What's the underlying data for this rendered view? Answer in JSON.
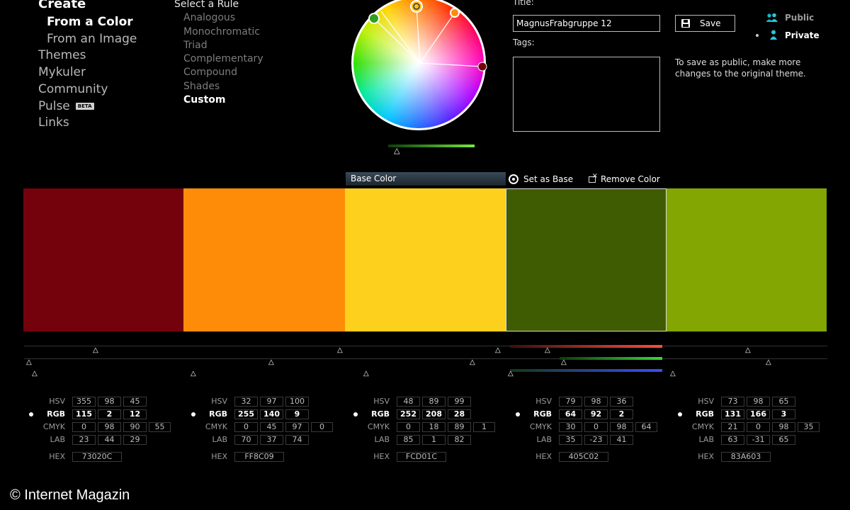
{
  "nav": {
    "create": "Create",
    "from_color": "From a Color",
    "from_image": "From an Image",
    "themes": "Themes",
    "mykuler": "Mykuler",
    "community": "Community",
    "pulse": "Pulse",
    "pulse_badge": "BETA",
    "links": "Links"
  },
  "rules": {
    "heading": "Select a Rule",
    "items": [
      "Analogous",
      "Monochromatic",
      "Triad",
      "Complementary",
      "Compound",
      "Shades",
      "Custom"
    ],
    "selected": "Custom"
  },
  "form": {
    "title_label": "Title:",
    "title_value": "MagnusFrabgruppe 12",
    "tags_label": "Tags:",
    "tags_value": "",
    "save_label": "Save",
    "public_label": "Public",
    "private_label": "Private",
    "visibility_selected": "Private",
    "save_note": "To save as public, make more changes to the original theme."
  },
  "toolbar": {
    "base_color_label": "Base Color",
    "set_as_base_label": "Set as Base",
    "remove_color_label": "Remove Color"
  },
  "value_labels": {
    "hsv": "HSV",
    "rgb": "RGB",
    "cmyk": "CMYK",
    "lab": "LAB",
    "hex": "HEX"
  },
  "swatches": [
    {
      "color": "#73020C",
      "hsv": [
        "355",
        "98",
        "45"
      ],
      "rgb": [
        "115",
        "2",
        "12"
      ],
      "cmyk": [
        "0",
        "98",
        "90",
        "55"
      ],
      "lab": [
        "23",
        "44",
        "29"
      ],
      "hex": "73020C",
      "selected": false
    },
    {
      "color": "#FF8C09",
      "hsv": [
        "32",
        "97",
        "100"
      ],
      "rgb": [
        "255",
        "140",
        "9"
      ],
      "cmyk": [
        "0",
        "45",
        "97",
        "0"
      ],
      "lab": [
        "70",
        "37",
        "74"
      ],
      "hex": "FF8C09",
      "selected": false
    },
    {
      "color": "#FCD01C",
      "hsv": [
        "48",
        "89",
        "99"
      ],
      "rgb": [
        "252",
        "208",
        "28"
      ],
      "cmyk": [
        "0",
        "18",
        "89",
        "1"
      ],
      "lab": [
        "85",
        "1",
        "82"
      ],
      "hex": "FCD01C",
      "selected": false
    },
    {
      "color": "#405C02",
      "hsv": [
        "79",
        "98",
        "36"
      ],
      "rgb": [
        "64",
        "92",
        "2"
      ],
      "cmyk": [
        "30",
        "0",
        "98",
        "64"
      ],
      "lab": [
        "35",
        "-23",
        "41"
      ],
      "hex": "405C02",
      "selected": true
    },
    {
      "color": "#83A603",
      "hsv": [
        "73",
        "98",
        "65"
      ],
      "rgb": [
        "131",
        "166",
        "3"
      ],
      "cmyk": [
        "21",
        "0",
        "98",
        "35"
      ],
      "lab": [
        "63",
        "-31",
        "65"
      ],
      "hex": "83A603",
      "selected": false
    }
  ],
  "copyright": "© Internet Magazin"
}
